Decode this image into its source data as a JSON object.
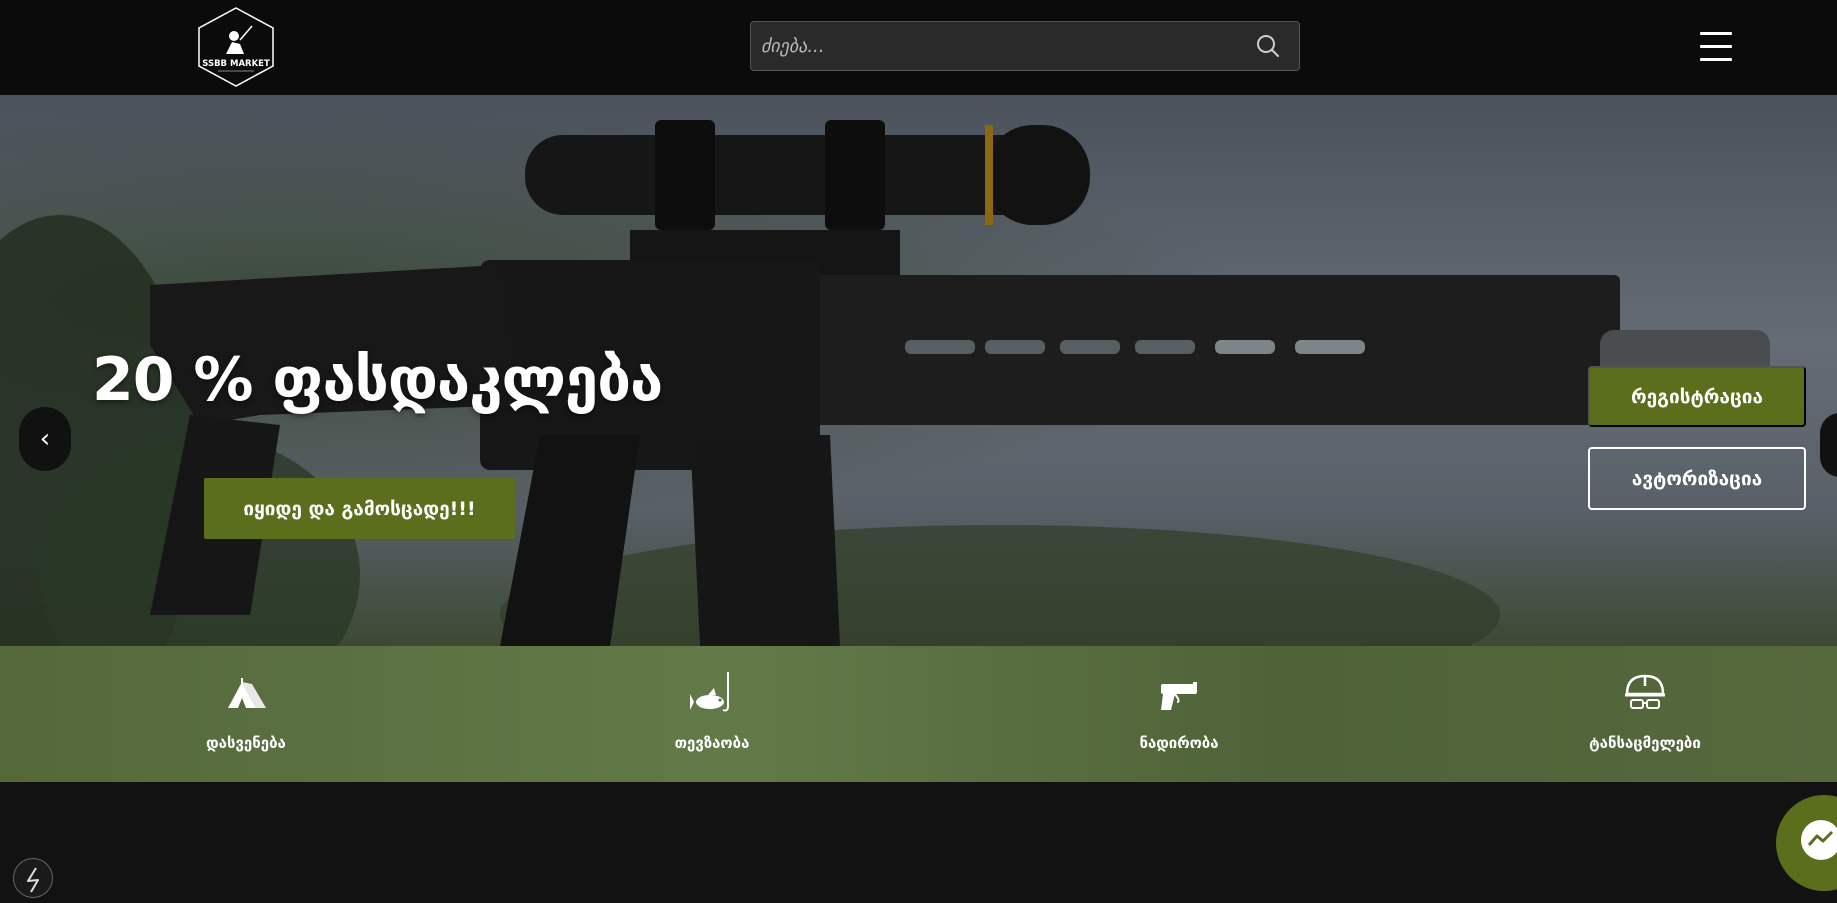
{
  "header": {
    "logo_text": "SSBB MARKET",
    "search_placeholder": "ძიება...",
    "icons": [
      "search-icon",
      "hamburger-menu-icon"
    ]
  },
  "hero": {
    "title": "20 % ფასდაკლება",
    "cta_label": "იყიდე და გამოსცადე!!!",
    "prev_label": "‹",
    "register_label": "რეგისტრაცია",
    "login_label": "ავტორიზაცია"
  },
  "categories": [
    {
      "label": "დასვენება",
      "icon": "tent-icon"
    },
    {
      "label": "თევზაობა",
      "icon": "fishing-icon"
    },
    {
      "label": "ნადირობა",
      "icon": "pistol-icon"
    },
    {
      "label": "ტანსაცმელები",
      "icon": "helmet-icon"
    }
  ],
  "colors": {
    "accent": "#5a6e1c",
    "header_bg": "#0b0b0b",
    "category_bar": "#5a6d40"
  }
}
